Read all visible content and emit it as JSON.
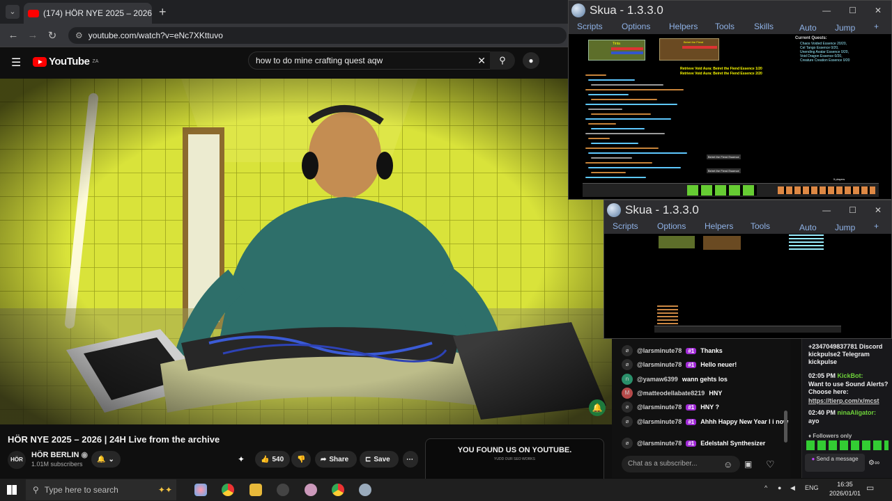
{
  "browser": {
    "tab_title": "(174) HÖR NYE 2025 – 2026",
    "url": "youtube.com/watch?v=eNc7XKttuvo"
  },
  "youtube": {
    "logo_text": "YouTube",
    "logo_region": "ZA",
    "search_query": "how to do mine crafting quest aqw",
    "video_title": "HÖR NYE 2025 – 2026 | 24H Live from the archive",
    "channel_avatar": "HÖR",
    "channel_name": "HÖR BERLIN",
    "subscribers": "1.01M subscribers",
    "like_count": "540",
    "share_label": "Share",
    "save_label": "Save",
    "ad_heading": "YOU FOUND US ON YOUTUBE.",
    "ad_sub": "YUDD OUR SEO WORKS"
  },
  "skua1": {
    "title": "Skua - 1.3.3.0",
    "menu": [
      "Scripts",
      "Options",
      "Helpers",
      "Tools",
      "Skills"
    ],
    "menu_right": [
      "Auto",
      "Jump",
      "+"
    ],
    "quests_heading": "Current Quests:",
    "quest_lines": [
      "Chaos Voided Essence 20/20,",
      "Cel Tango Essence 0/20,",
      "Unending Avatar Essence 0/20,",
      "Void Dragon Essence 0/20,",
      "Creature Creation Essence 0/20"
    ],
    "void_lines": [
      "Retrieve Void Aura: Beiret the Fiend Essence 1/20",
      "Retrieve Void Aura: Beiret the Fiend Essence 2/20"
    ],
    "player_name": "Tinta",
    "enemy_name": "Beiret the Fiend",
    "drop_labels": [
      "Beiret the Fiend Essence",
      "Beiret the Fiend Essence"
    ],
    "players_count": "5 players"
  },
  "skua2": {
    "title": "Skua - 1.3.3.0",
    "menu": [
      "Scripts",
      "Options",
      "Helpers",
      "Tools"
    ],
    "menu_right": [
      "Auto",
      "Jump",
      "+"
    ]
  },
  "window_controls": {
    "min": "—",
    "max": "☐",
    "close": "✕"
  },
  "chat_left": {
    "messages": [
      {
        "user": "@larsminute78",
        "badge": "#1",
        "text": "Thanks"
      },
      {
        "user": "@larsminute78",
        "badge": "#1",
        "text": "Hello neuer!"
      },
      {
        "user": "@yamaw6399",
        "badge": "",
        "text": "wann gehts los",
        "avatar": "n"
      },
      {
        "user": "@matteodellabate8219",
        "badge": "",
        "text": "HNY",
        "avatar": "M"
      },
      {
        "user": "@larsminute78",
        "badge": "#1",
        "text": "HNY ?"
      },
      {
        "user": "@larsminute78",
        "badge": "#1",
        "text": "Ahhh Happy New Year I i now"
      },
      {
        "user": "@larsminute78",
        "badge": "#1",
        "text": "Edelstahl Synthesizer"
      }
    ],
    "input_placeholder": "Chat as a subscriber..."
  },
  "chat_right": {
    "lines": [
      "+2347049837781 Discord",
      "kickpulse2 Telegram",
      "kickpulse"
    ],
    "kick_time": "02:05 PM",
    "kick_user": "KickBot:",
    "kick_msg": "Want to use Sound Alerts? Choose here:",
    "kick_link": "https://tierp.com/x/mcst",
    "ali_time": "02:40 PM",
    "ali_user": "ninaAligator:",
    "ali_msg": "ayo",
    "followers_only": "Followers only",
    "send_label": "Send a message"
  },
  "taskbar": {
    "search_placeholder": "Type here to search",
    "lang": "ENG",
    "time": "16:35",
    "date": "2026/01/01"
  }
}
